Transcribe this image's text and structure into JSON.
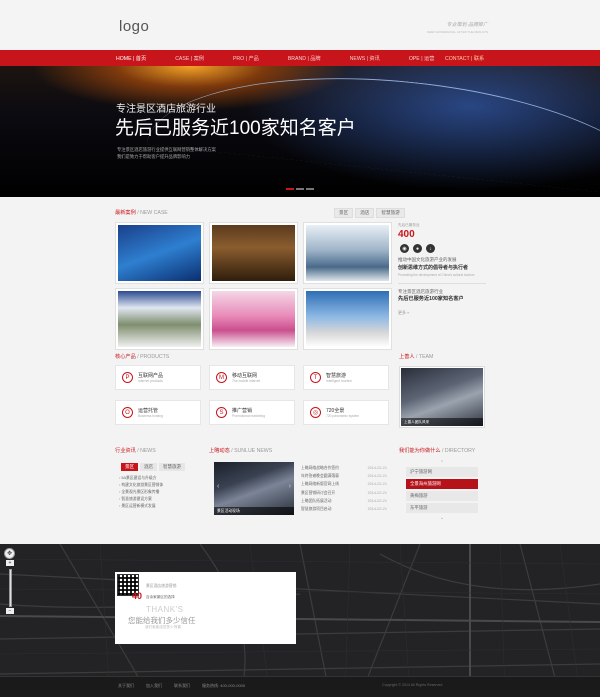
{
  "header": {
    "logo": "logo",
    "slogan_cn": "专业策划  品牌推广",
    "slogan_en": "DEEP EXPERIENCE, AFTER THE RESULTS"
  },
  "nav": [
    {
      "en": "HOME",
      "cn": "首页",
      "active": true
    },
    {
      "en": "CASE",
      "cn": "案例",
      "active": false
    },
    {
      "en": "PRO",
      "cn": "产品",
      "active": false
    },
    {
      "en": "BRAND",
      "cn": "品牌",
      "active": false
    },
    {
      "en": "NEWS",
      "cn": "资讯",
      "active": false
    },
    {
      "en": "OPE",
      "cn": "运营",
      "active": false
    },
    {
      "en": "CONTACT",
      "cn": "联系",
      "active": false
    }
  ],
  "banner": {
    "subtitle": "专注景区酒店旅游行业",
    "headline": "先后已服务近100家知名客户",
    "desc_line1": "专注景区酒店旅游行业提供互联网营销整体解决方案",
    "desc_line2": "我们是致力于帮助客户提升品牌影响力"
  },
  "case": {
    "title_cn": "最新案例",
    "title_en": "/ NEW CASE",
    "tabs": [
      "景区",
      "酒店",
      "智慧旅游"
    ],
    "side": {
      "small": "先后已服务近",
      "big": "400",
      "line1": "推动中国文化旅游产业的发展",
      "line2": "创新思维方式的倡导者与执行者",
      "line3": "Promoting the development of China's cultural tourism",
      "line4": "专注景区酒店旅游行业",
      "line5": "先后已服务近100家知名客户",
      "more": "更多 »"
    }
  },
  "products": {
    "title_cn": "核心产品",
    "title_en": "/ PRODUCTS",
    "items": [
      {
        "cn": "互联网产品",
        "en": "Internet products",
        "icon": "P"
      },
      {
        "cn": "移动互联网",
        "en": "The mobile internet",
        "icon": "M"
      },
      {
        "cn": "智慧旅游",
        "en": "Intelligent tourism",
        "icon": "T"
      },
      {
        "cn": "运营托管",
        "en": "Business hosting",
        "icon": "O"
      },
      {
        "cn": "推广营销",
        "en": "Promotional marketing",
        "icon": "S"
      },
      {
        "cn": "720全景",
        "en": "720 panoramic system",
        "icon": "◎"
      }
    ]
  },
  "team": {
    "title_cn": "上善人",
    "title_en": "/ TEAM",
    "caption": "上善人团队风采"
  },
  "news": {
    "title_cn": "行业资讯",
    "title_en": "/ NEWS",
    "tabs": [
      "景区",
      "酒店",
      "智慧旅游"
    ],
    "items": [
      "5A景区建设与升级方",
      "构建文化旅游景区营销体",
      "全景观光景区形象传播",
      "智慧旅游建设方案",
      "景区运营新模式发展"
    ]
  },
  "sunlue_news": {
    "title_cn": "上略动态",
    "title_en": "/ SUNLUE NEWS",
    "photo_caption": "景区活动现场",
    "items": [
      {
        "title": "上略网络战略合作签约",
        "date": "2014-02-21"
      },
      {
        "title": "年终答谢晚会圆满落幕",
        "date": "2014-02-21"
      },
      {
        "title": "上略网络新版官网上线",
        "date": "2014-02-21"
      },
      {
        "title": "景区营销研讨会召开",
        "date": "2014-02-21"
      },
      {
        "title": "上略团队拓展活动",
        "date": "2014-02-21"
      },
      {
        "title": "智慧旅游项目启动",
        "date": "2014-02-21"
      }
    ]
  },
  "directory": {
    "title_cn": "我们能为你做什么",
    "title_en": "/ DIRECTORY",
    "items": [
      "沪宁旅游网",
      "全景海州旅游网",
      "黄梅旅游",
      "东平旅游"
    ],
    "selected_index": 1
  },
  "contact_card": {
    "tagline": "景区酒店旅游营销",
    "big": "40",
    "tag2": "百余家景区的选择",
    "thanks": "THANK'S",
    "trust": "您能给我们多少信任",
    "trust_sub": "我们就能给您多少惊喜"
  },
  "footer": {
    "links": [
      "关于我们",
      "加入我们",
      "联系我们",
      "服务热线: 400-000-0000"
    ],
    "copyright": "Copyright © 2014 All Rights Reserved"
  }
}
